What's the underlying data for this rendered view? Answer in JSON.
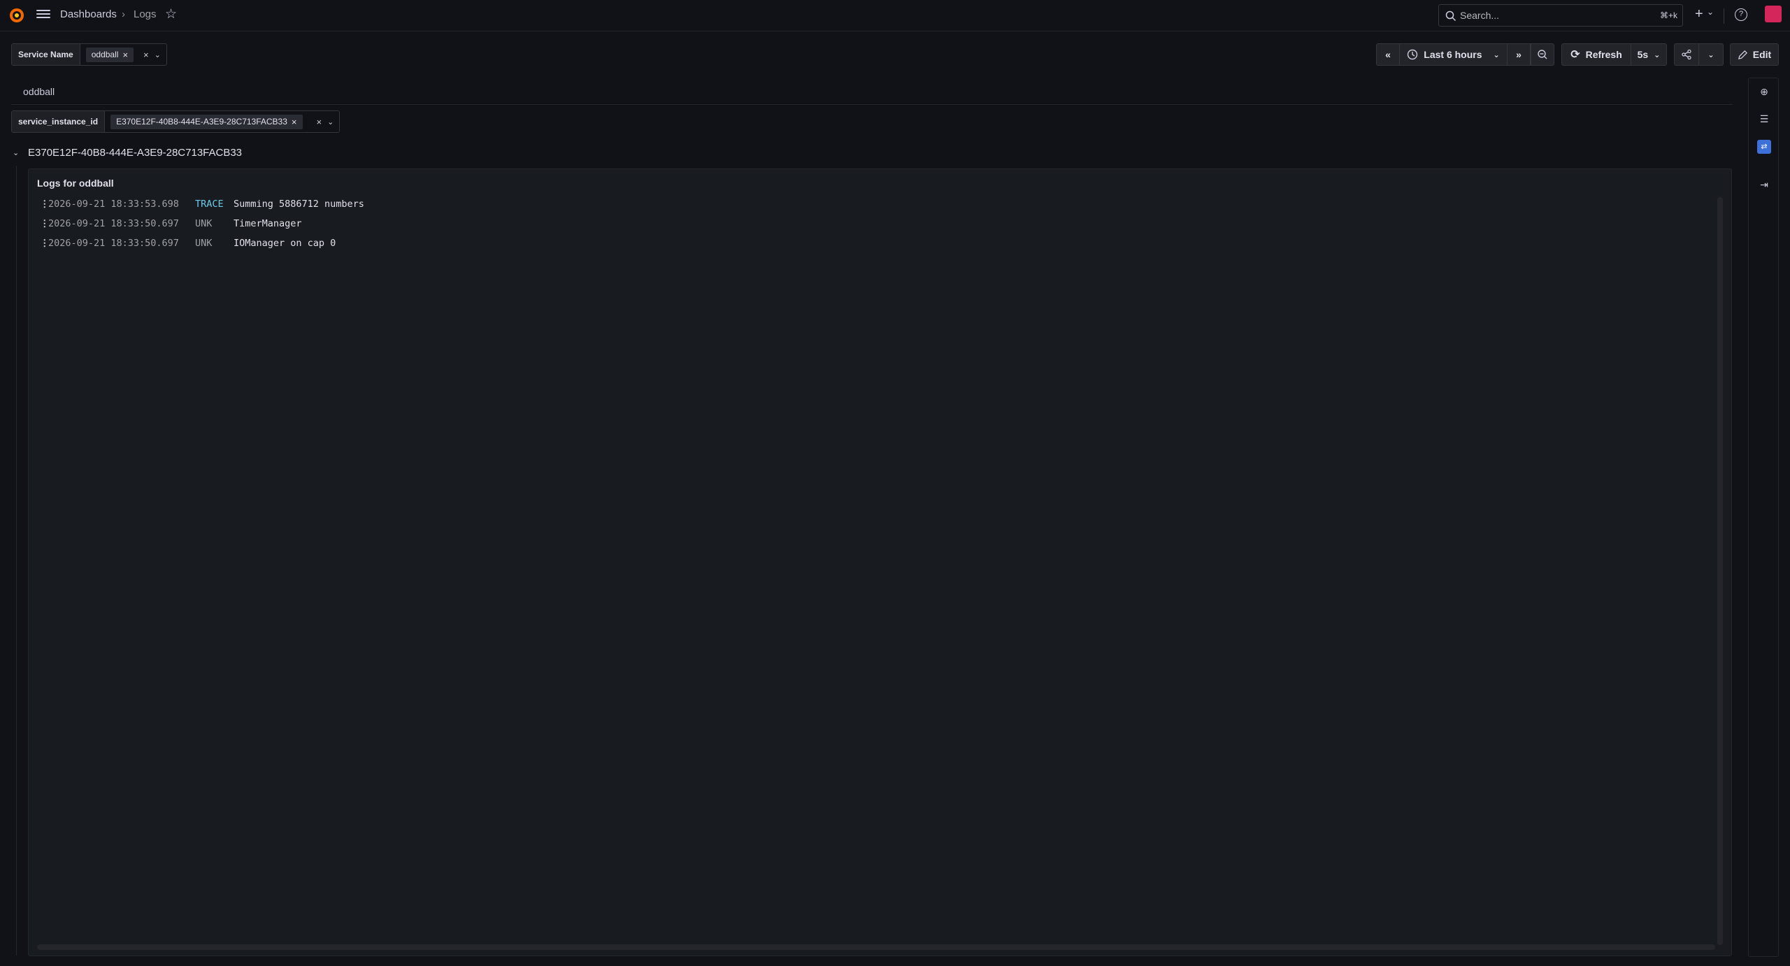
{
  "topbar": {
    "breadcrumb": [
      "Dashboards",
      "Logs"
    ],
    "breadcrumb_separator": "›",
    "search_placeholder": "Search...",
    "search_shortcut": "⌘+k"
  },
  "variables": [
    {
      "label": "Service Name",
      "value": "oddball"
    },
    {
      "label": "service_instance_id",
      "value": "E370E12F-40B8-444E-A3E9-28C713FACB33"
    }
  ],
  "toolbar": {
    "time_range": "Last 6 hours",
    "refresh_label": "Refresh",
    "refresh_interval": "5s",
    "edit_label": "Edit"
  },
  "row_title": "oddball",
  "group_title": "E370E12F-40B8-444E-A3E9-28C713FACB33",
  "panel": {
    "title": "Logs for oddball",
    "logs": [
      {
        "timestamp": "2026-09-21 18:33:53.698",
        "level": "TRACE",
        "message": "Summing 5886712 numbers"
      },
      {
        "timestamp": "2026-09-21 18:33:50.697",
        "level": "UNK",
        "message": "TimerManager"
      },
      {
        "timestamp": "2026-09-21 18:33:50.697",
        "level": "UNK",
        "message": "IOManager on cap 0"
      }
    ]
  },
  "colors": {
    "background": "#111217",
    "panel": "#181b1f",
    "trace_level": "#6ccae6",
    "accent": "#3d71d9"
  },
  "icons": [
    "grafana-logo-icon",
    "hamburger-menu-icon",
    "star-icon",
    "search-icon",
    "plus-icon",
    "help-icon",
    "avatar-icon",
    "clock-icon",
    "zoom-out-icon",
    "refresh-icon",
    "share-icon",
    "pencil-icon",
    "add-panel-icon",
    "outline-icon",
    "edit-pane-icon",
    "dock-icon"
  ]
}
